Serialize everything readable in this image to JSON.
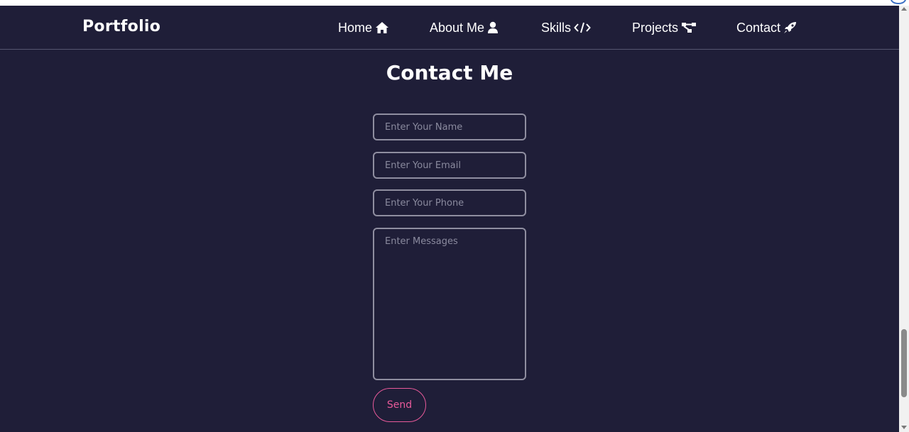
{
  "navbar": {
    "brand": "Portfolio",
    "items": [
      {
        "label": "Home",
        "icon": "home-icon"
      },
      {
        "label": "About Me",
        "icon": "user-icon"
      },
      {
        "label": "Skills",
        "icon": "code-icon"
      },
      {
        "label": "Projects",
        "icon": "project-diagram-icon"
      },
      {
        "label": "Contact",
        "icon": "rocket-icon"
      }
    ]
  },
  "contact": {
    "title": "Contact Me",
    "name_placeholder": "Enter Your Name",
    "email_placeholder": "Enter Your Email",
    "phone_placeholder": "Enter Your Phone",
    "message_placeholder": "Enter Messages",
    "send_label": "Send"
  },
  "colors": {
    "background": "#1f1e38",
    "text": "#ffffff",
    "accent": "#e85a9a",
    "input_border": "#8f8ea0"
  }
}
